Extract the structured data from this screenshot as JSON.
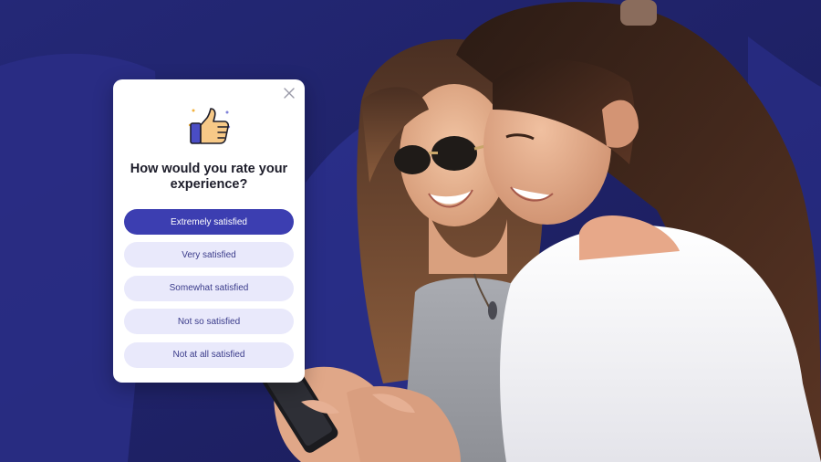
{
  "survey": {
    "question": "How would you rate your experience?",
    "options": [
      {
        "label": "Extremely satisfied"
      },
      {
        "label": "Very satisfied"
      },
      {
        "label": "Somewhat satisfied"
      },
      {
        "label": "Not so satisfied"
      },
      {
        "label": "Not at all satisfied"
      }
    ],
    "selected": "Extremely satisfied",
    "icon": "thumbs-up-icon",
    "close_icon": "close-icon"
  },
  "colors": {
    "background": "#1e2161",
    "accent": "#3c3eb1",
    "option_bg": "#e9e9fb",
    "option_text": "#3a3b8a"
  }
}
